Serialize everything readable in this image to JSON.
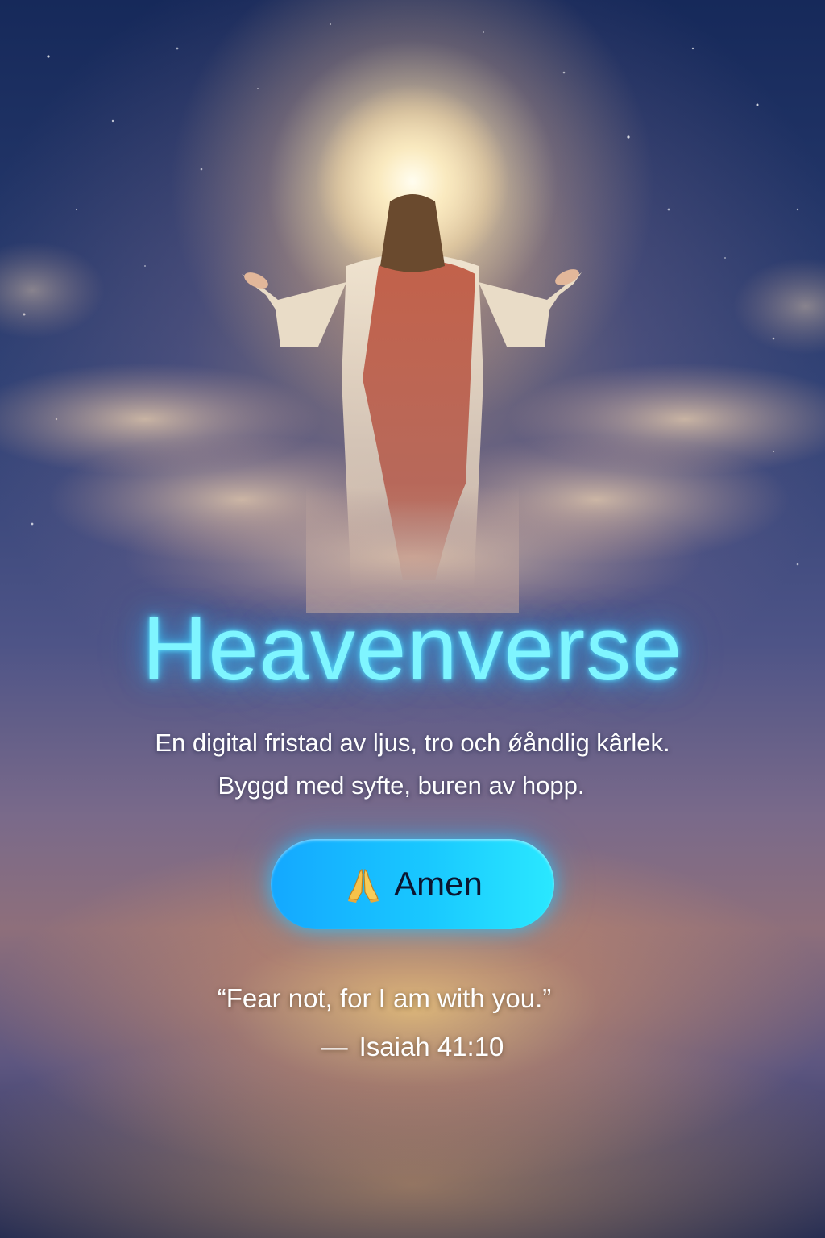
{
  "app": {
    "title": "Heavenverse"
  },
  "hero": {
    "tagline_line1": "En digital fristad av ljus, tro och ǿåndlig kârlek.",
    "tagline_line2": "Byggd med syfte, buren av hopp."
  },
  "action": {
    "icon": "praying-hands-icon",
    "label": "Amen",
    "gradient_start": "#14a8ff",
    "gradient_end": "#2ae8ff"
  },
  "verse": {
    "quote": "“Fear not, for I am with you.”",
    "dash": "—",
    "reference": "Isaiah 41:10"
  },
  "colors": {
    "title_glow": "#7ff5ff",
    "text": "#ffffff",
    "sky_dark": "#16295a",
    "sky_warm": "#8e6f7b"
  }
}
